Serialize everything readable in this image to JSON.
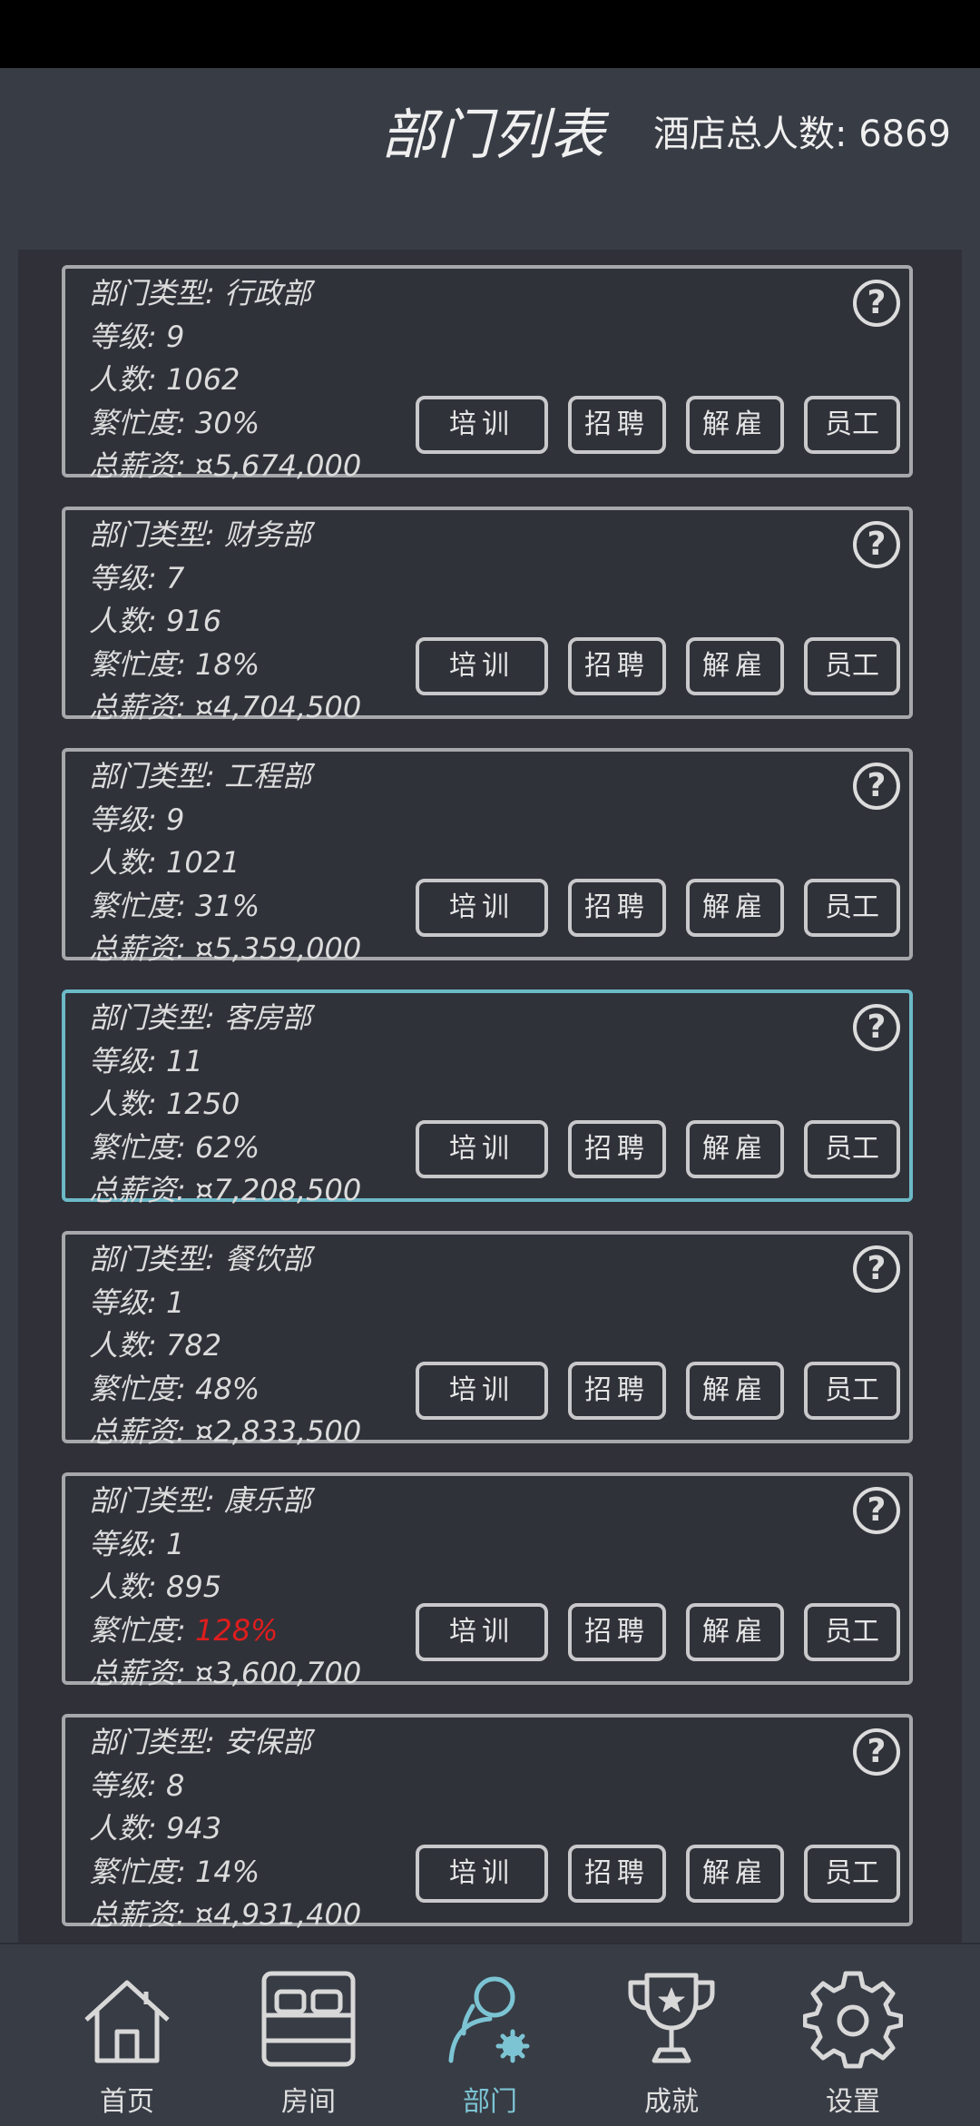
{
  "header": {
    "title": "部门列表",
    "total_staff": "酒店总人数: 6869"
  },
  "labels": {
    "type": "部门类型: ",
    "level": "等级: ",
    "count": "人数: ",
    "busy": "繁忙度: ",
    "salary": "总薪资: "
  },
  "buttons": {
    "train": "培训",
    "hire": "招聘",
    "fire": "解雇",
    "staff": "员工",
    "help": "?"
  },
  "departments": [
    {
      "type": "行政部",
      "level": "9",
      "count": "1062",
      "busy": "30%",
      "salary": "¤5,674,000"
    },
    {
      "type": "财务部",
      "level": "7",
      "count": "916",
      "busy": "18%",
      "salary": "¤4,704,500"
    },
    {
      "type": "工程部",
      "level": "9",
      "count": "1021",
      "busy": "31%",
      "salary": "¤5,359,000"
    },
    {
      "type": "客房部",
      "level": "11",
      "count": "1250",
      "busy": "62%",
      "salary": "¤7,208,500"
    },
    {
      "type": "餐饮部",
      "level": "1",
      "count": "782",
      "busy": "48%",
      "salary": "¤2,833,500"
    },
    {
      "type": "康乐部",
      "level": "1",
      "count": "895",
      "busy": "128%",
      "salary": "¤3,600,700"
    },
    {
      "type": "安保部",
      "level": "8",
      "count": "943",
      "busy": "14%",
      "salary": "¤4,931,400"
    }
  ],
  "nav": [
    {
      "label": "首页",
      "icon": "home-icon"
    },
    {
      "label": "房间",
      "icon": "bed-icon"
    },
    {
      "label": "部门",
      "icon": "staff-gear-icon"
    },
    {
      "label": "成就",
      "icon": "trophy-icon"
    },
    {
      "label": "设置",
      "icon": "gear-icon"
    }
  ],
  "colors": {
    "background": "#383c45",
    "panel": "#2f3038",
    "card_border": "#a7a8ab",
    "selected_border": "#6cb9c8",
    "active_nav": "#7cc4d3",
    "warning": "#e01d1d"
  }
}
